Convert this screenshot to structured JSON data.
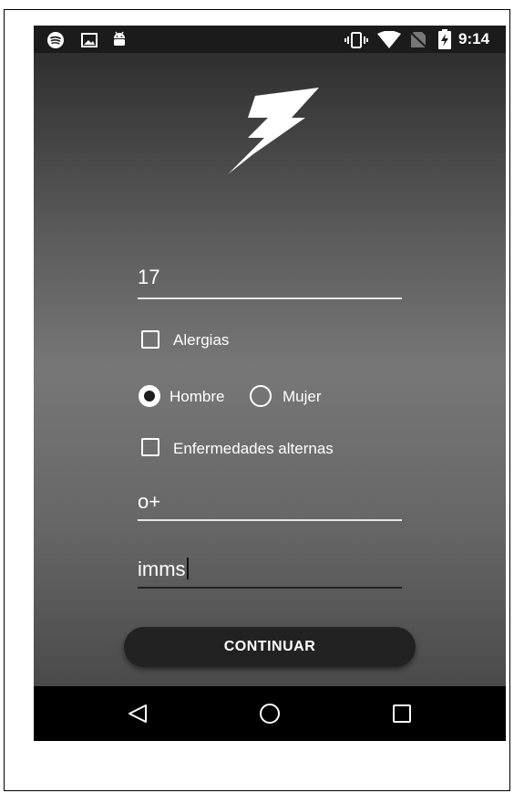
{
  "status_bar": {
    "time": "9:14",
    "left_icons": [
      "spotify-icon",
      "image-icon",
      "android-icon"
    ],
    "right_icons": [
      "vibrate-icon",
      "wifi-icon",
      "no-sim-icon",
      "battery-charging-icon"
    ]
  },
  "app": {
    "logo_icon": "lightning-bolt-icon",
    "age_field": {
      "value": "17"
    },
    "allergies_checkbox": {
      "label": "Alergias",
      "checked": false
    },
    "gender": {
      "options": [
        {
          "label": "Hombre",
          "selected": true
        },
        {
          "label": "Mujer",
          "selected": false
        }
      ]
    },
    "other_diseases_checkbox": {
      "label": "Enfermedades alternas",
      "checked": false
    },
    "blood_type_field": {
      "value": "o+"
    },
    "insurance_field": {
      "value": "imms"
    },
    "continue_button": {
      "label": "CONTINUAR"
    }
  },
  "nav_bar": {
    "icons": [
      "back-icon",
      "home-icon",
      "recents-icon"
    ]
  },
  "colors": {
    "status_bar": "#1b1b1b",
    "nav_bar": "#000000",
    "button": "#222222",
    "text": "#ffffff"
  }
}
